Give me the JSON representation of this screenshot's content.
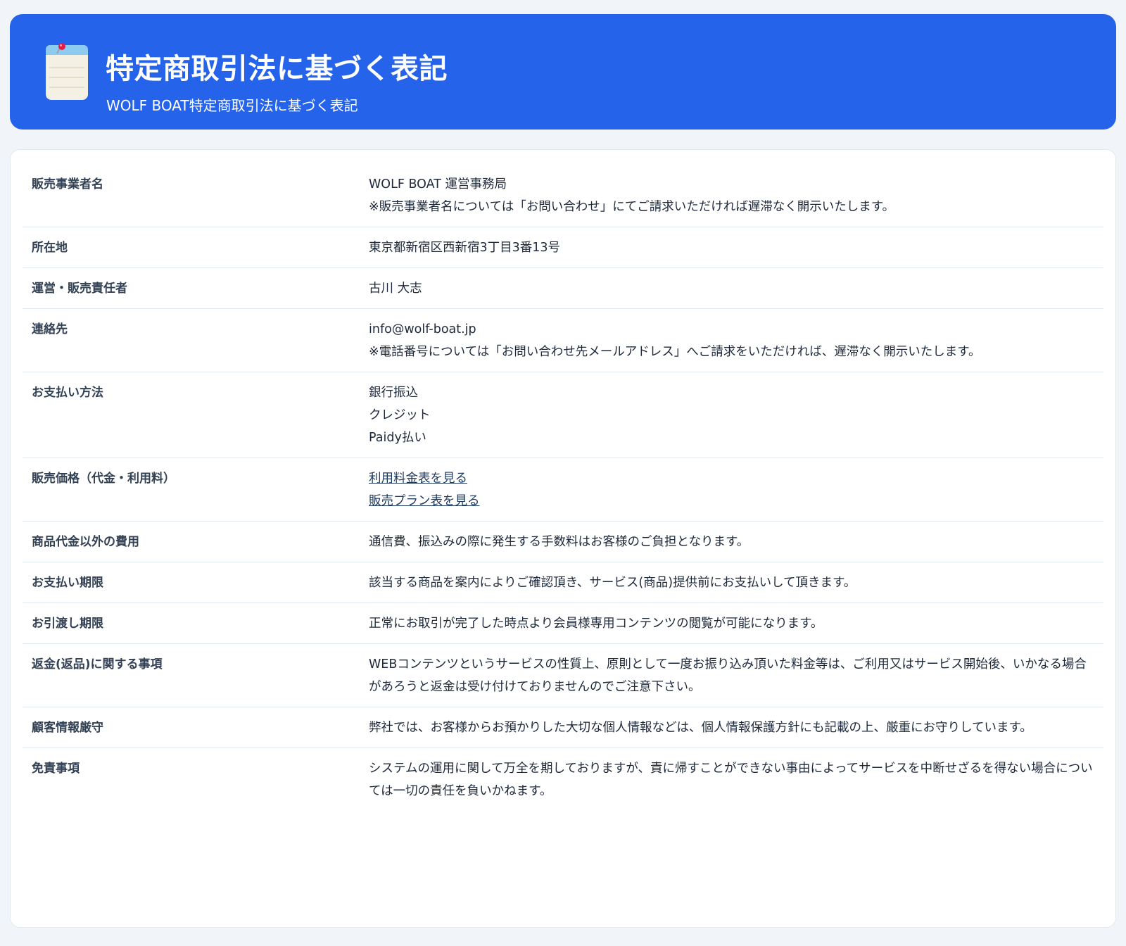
{
  "header": {
    "icon": "notepad-pushpin-icon",
    "title": "特定商取引法に基づく表記",
    "subtitle": "WOLF BOAT特定商取引法に基づく表記"
  },
  "colors": {
    "header_background": "#2563eb",
    "page_background": "#f1f5f9",
    "link": "#1e3a5f"
  },
  "rows": [
    {
      "label": "販売事業者名",
      "values": [
        "WOLF BOAT 運営事務局",
        "※販売事業者名については「お問い合わせ」にてご請求いただければ遅滞なく開示いたします。"
      ]
    },
    {
      "label": "所在地",
      "values": [
        "東京都新宿区西新宿3丁目3番13号"
      ]
    },
    {
      "label": "運営・販売責任者",
      "values": [
        "古川 大志"
      ]
    },
    {
      "label": "連絡先",
      "values": [
        "info@wolf-boat.jp",
        "※電話番号については「お問い合わせ先メールアドレス」へご請求をいただければ、遅滞なく開示いたします。"
      ]
    },
    {
      "label": "お支払い方法",
      "values": [
        "銀行振込",
        "クレジット",
        "Paidy払い"
      ]
    },
    {
      "label": "販売価格（代金・利用料）",
      "links": [
        "利用料金表を見る",
        "販売プラン表を見る"
      ]
    },
    {
      "label": "商品代金以外の費用",
      "values": [
        "通信費、振込みの際に発生する手数料はお客様のご負担となります。"
      ]
    },
    {
      "label": "お支払い期限",
      "values": [
        "該当する商品を案内によりご確認頂き、サービス(商品)提供前にお支払いして頂きます。"
      ]
    },
    {
      "label": "お引渡し期限",
      "values": [
        "正常にお取引が完了した時点より会員様専用コンテンツの閲覧が可能になります。"
      ]
    },
    {
      "label": "返金(返品)に関する事項",
      "values": [
        "WEBコンテンツというサービスの性質上、原則として一度お振り込み頂いた料金等は、ご利用又はサービス開始後、いかなる場合があろうと返金は受け付けておりませんのでご注意下さい。"
      ]
    },
    {
      "label": "顧客情報厳守",
      "values": [
        "弊社では、お客様からお預かりした大切な個人情報などは、個人情報保護方針にも記載の上、厳重にお守りしています。"
      ]
    },
    {
      "label": "免責事項",
      "values": [
        "システムの運用に関して万全を期しておりますが、責に帰すことができない事由によってサービスを中断せざるを得ない場合については一切の責任を負いかねます。"
      ]
    }
  ]
}
